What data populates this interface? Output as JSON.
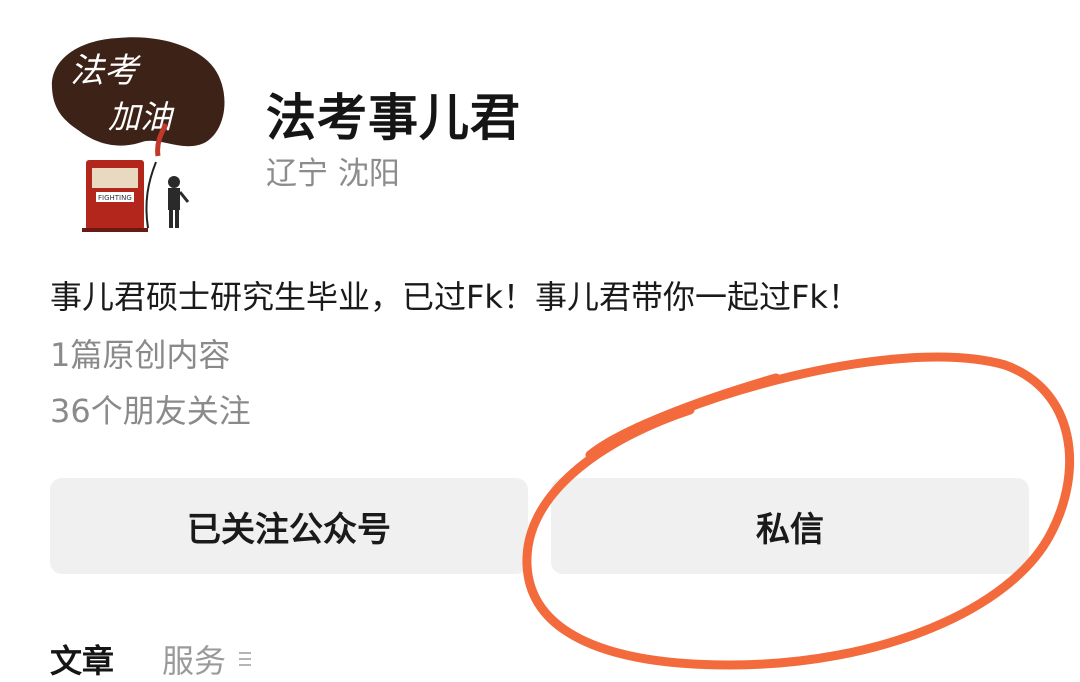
{
  "profile": {
    "avatar_text_line1": "法考",
    "avatar_text_line2": "加油",
    "avatar_sign_text": "FIGHTING",
    "name": "法考事儿君",
    "location": "辽宁 沈阳",
    "bio": "事儿君硕士研究生毕业，已过Fk！事儿君带你一起过Fk！",
    "original_count_text": "1篇原创内容",
    "followers_text": "36个朋友关注"
  },
  "actions": {
    "follow_label": "已关注公众号",
    "message_label": "私信"
  },
  "tabs": [
    {
      "label": "文章"
    },
    {
      "label": "服务"
    }
  ],
  "icons": {
    "services_menu": "menu-lines-icon"
  },
  "colors": {
    "annotation_circle": "#f36b3d",
    "button_bg": "#f0f0f0",
    "avatar_blob": "#3d2218",
    "pump_red": "#b2261c"
  }
}
